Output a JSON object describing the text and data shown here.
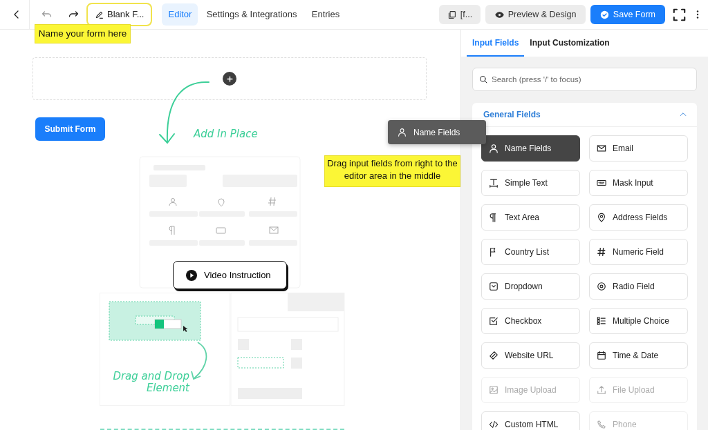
{
  "toolbar": {
    "back": {
      "disabled": false
    },
    "undo": {
      "disabled": true
    },
    "redo": {
      "disabled": false
    },
    "form_name": "Blank F...",
    "tabs": [
      {
        "label": "Editor",
        "selected": true
      },
      {
        "label": "Settings & Integrations",
        "selected": false
      },
      {
        "label": "Entries",
        "selected": false
      }
    ],
    "shortcode": "[f...",
    "preview": "Preview & Design",
    "save": "Save Form"
  },
  "annotations": [
    {
      "text": "Name your form here"
    },
    {
      "text": "Drag input fields from right to the editor area in the middle"
    }
  ],
  "editor": {
    "submit": "Submit Form",
    "dragged_item": "Name Fields",
    "add_label": "Add In Place",
    "video": "Video Instruction",
    "drop_label": "Drag and Drop Element"
  },
  "panel": {
    "tabs": [
      {
        "label": "Input Fields",
        "selected": true
      },
      {
        "label": "Input Customization",
        "selected": false
      }
    ],
    "search": {
      "placeholder": "Search (press '/' to focus)"
    },
    "section": {
      "title": "General Fields",
      "expanded": true,
      "fields": [
        {
          "label": "Name Fields",
          "dragging": true,
          "disabled": false
        },
        {
          "label": "Email",
          "dragging": false,
          "disabled": false
        },
        {
          "label": "Simple Text",
          "dragging": false,
          "disabled": false
        },
        {
          "label": "Mask Input",
          "dragging": false,
          "disabled": false
        },
        {
          "label": "Text Area",
          "dragging": false,
          "disabled": false
        },
        {
          "label": "Address Fields",
          "dragging": false,
          "disabled": false
        },
        {
          "label": "Country List",
          "dragging": false,
          "disabled": false
        },
        {
          "label": "Numeric Field",
          "dragging": false,
          "disabled": false
        },
        {
          "label": "Dropdown",
          "dragging": false,
          "disabled": false
        },
        {
          "label": "Radio Field",
          "dragging": false,
          "disabled": false
        },
        {
          "label": "Checkbox",
          "dragging": false,
          "disabled": false
        },
        {
          "label": "Multiple Choice",
          "dragging": false,
          "disabled": false
        },
        {
          "label": "Website URL",
          "dragging": false,
          "disabled": false
        },
        {
          "label": "Time & Date",
          "dragging": false,
          "disabled": false
        },
        {
          "label": "Image Upload",
          "dragging": false,
          "disabled": true
        },
        {
          "label": "File Upload",
          "dragging": false,
          "disabled": true
        },
        {
          "label": "Custom HTML",
          "dragging": false,
          "disabled": false
        },
        {
          "label": "Phone",
          "dragging": false,
          "disabled": true
        }
      ]
    }
  }
}
